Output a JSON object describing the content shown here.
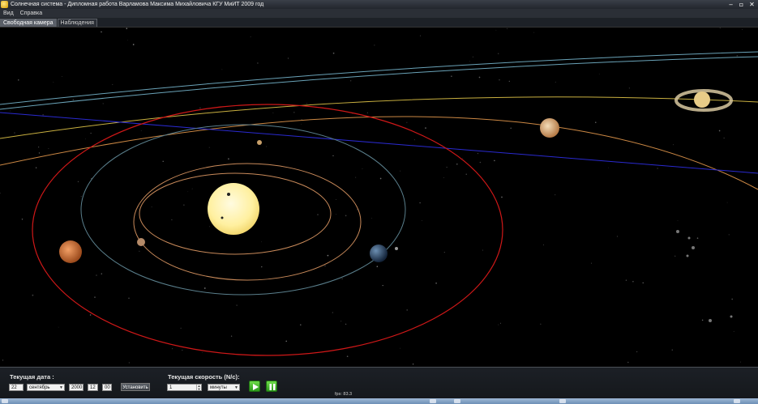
{
  "window": {
    "title": "Солнечная система - Дипломная работа Варламова Максима Михайловича КГУ МиИТ 2009 год",
    "controls": [
      "minimize-icon",
      "maximize-icon",
      "close-icon"
    ]
  },
  "menu": {
    "items": [
      "Вид",
      "Справка"
    ]
  },
  "tabs": [
    {
      "label": "Свободная камера",
      "active": true
    },
    {
      "label": "Наблюдения",
      "active": false
    }
  ],
  "panel": {
    "date_label": "Текущая дата :",
    "day": "22",
    "month": "сентябрь",
    "year": "2000",
    "hour": "12",
    "minute": "00",
    "set_button": "Установить",
    "speed_label": "Текущая скорость (N/c):",
    "speed_value": "1",
    "speed_unit": "минуты",
    "play_icon": "play-icon",
    "pause_icon": "pause-icon",
    "fps": "fps: 83.3"
  },
  "scene": {
    "background": "#000000",
    "sun_color": "#fff2a8",
    "orbit_colors": {
      "venus": "#c98a5a",
      "earth": "#5a7f8c",
      "mars": "#d01818",
      "jupiter": "#cc8844",
      "saturn": "#c9b040",
      "uranus": "#6aa3b8",
      "ecliptic": "#2a2ad0"
    }
  }
}
